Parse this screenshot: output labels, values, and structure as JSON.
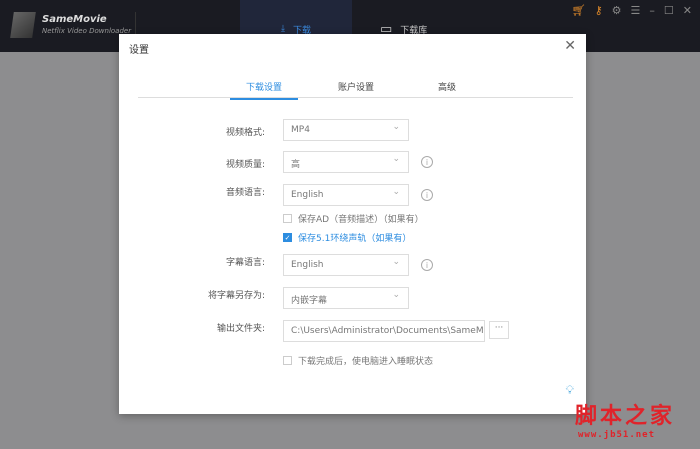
{
  "app": {
    "name": "SameMovie",
    "subtitle": "Netflix Video Downloader",
    "nav": [
      {
        "label": "下载",
        "icon": "download-icon"
      },
      {
        "label": "下载库",
        "icon": "monitor-icon"
      }
    ]
  },
  "dialog": {
    "title": "设置",
    "tabs": [
      "下载设置",
      "账户设置",
      "高级"
    ],
    "fields": {
      "video_format": {
        "label": "视频格式:",
        "value": "MP4"
      },
      "video_quality": {
        "label": "视频质量:",
        "value": "高"
      },
      "audio_language": {
        "label": "音频语言:",
        "value": "English"
      },
      "save_ad": {
        "label": "保存AD（音频描述）（如果有）",
        "checked": false
      },
      "save_51": {
        "label": "保存5.1环绕声轨（如果有）",
        "checked": true
      },
      "subtitle_language": {
        "label": "字幕语言:",
        "value": "English"
      },
      "subtitle_save_as": {
        "label": "将字幕另存为:",
        "value": "内嵌字幕"
      },
      "output_folder": {
        "label": "输出文件夹:",
        "value": "C:\\Users\\Administrator\\Documents\\SameMovie",
        "browse": "···"
      },
      "sleep_after": {
        "label": "下载完成后，使电脑进入睡眠状态",
        "checked": false
      }
    }
  },
  "watermark": {
    "text": "脚本之家",
    "url": "www.jb51.net"
  },
  "colors": {
    "accent": "#2d8de0",
    "topbar": "#1a1b22"
  }
}
